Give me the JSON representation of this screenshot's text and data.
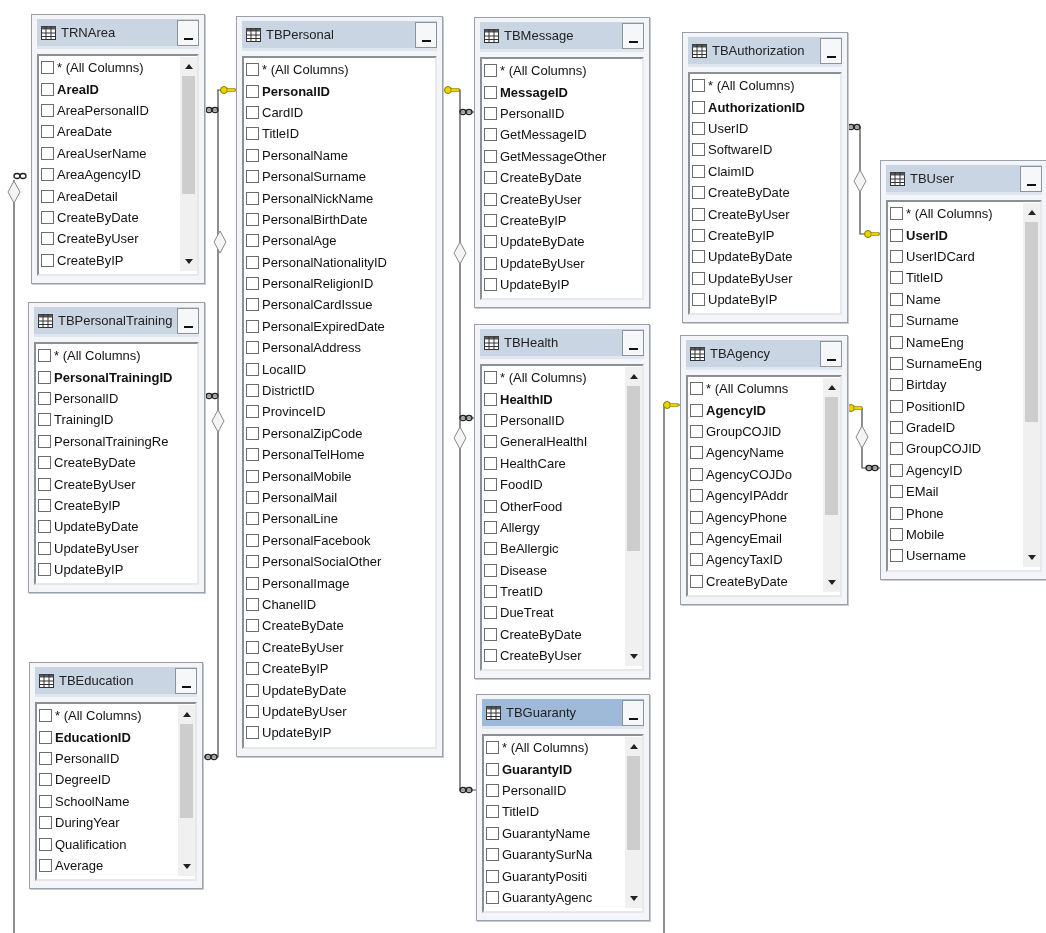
{
  "tables": [
    {
      "name": "TRNArea",
      "selected": false,
      "scrollable": true,
      "columns": [
        {
          "name": "* (All Columns)",
          "key": false,
          "checked": false
        },
        {
          "name": "AreaID",
          "key": true,
          "checked": false
        },
        {
          "name": "AreaPersonalID",
          "key": false,
          "checked": false
        },
        {
          "name": "AreaDate",
          "key": false,
          "checked": false
        },
        {
          "name": "AreaUserName",
          "key": false,
          "checked": false
        },
        {
          "name": "AreaAgencyID",
          "key": false,
          "checked": false
        },
        {
          "name": "AreaDetail",
          "key": false,
          "checked": false
        },
        {
          "name": "CreateByDate",
          "key": false,
          "checked": false
        },
        {
          "name": "CreateByUser",
          "key": false,
          "checked": false
        },
        {
          "name": "CreateByIP",
          "key": false,
          "checked": false
        }
      ]
    },
    {
      "name": "TBPersonal",
      "selected": false,
      "scrollable": false,
      "columns": [
        {
          "name": "* (All Columns)",
          "key": false,
          "checked": false
        },
        {
          "name": "PersonalID",
          "key": true,
          "checked": false
        },
        {
          "name": "CardID",
          "key": false,
          "checked": false
        },
        {
          "name": "TitleID",
          "key": false,
          "checked": false
        },
        {
          "name": "PersonalName",
          "key": false,
          "checked": false
        },
        {
          "name": "PersonalSurname",
          "key": false,
          "checked": false
        },
        {
          "name": "PersonalNickName",
          "key": false,
          "checked": false
        },
        {
          "name": "PersonalBirthDate",
          "key": false,
          "checked": false
        },
        {
          "name": "PersonalAge",
          "key": false,
          "checked": false
        },
        {
          "name": "PersonalNationalityID",
          "key": false,
          "checked": false
        },
        {
          "name": "PersonalReligionID",
          "key": false,
          "checked": false
        },
        {
          "name": "PersonalCardIssue",
          "key": false,
          "checked": false
        },
        {
          "name": "PersonalExpiredDate",
          "key": false,
          "checked": false
        },
        {
          "name": "PersonalAddress",
          "key": false,
          "checked": false
        },
        {
          "name": "LocalID",
          "key": false,
          "checked": false
        },
        {
          "name": "DistrictID",
          "key": false,
          "checked": false
        },
        {
          "name": "ProvinceID",
          "key": false,
          "checked": false
        },
        {
          "name": "PersonalZipCode",
          "key": false,
          "checked": false
        },
        {
          "name": "PersonalTelHome",
          "key": false,
          "checked": false
        },
        {
          "name": "PersonalMobile",
          "key": false,
          "checked": false
        },
        {
          "name": "PersonalMail",
          "key": false,
          "checked": false
        },
        {
          "name": "PersonalLine",
          "key": false,
          "checked": false
        },
        {
          "name": "PersonalFacebook",
          "key": false,
          "checked": false
        },
        {
          "name": "PersonalSocialOther",
          "key": false,
          "checked": false
        },
        {
          "name": "PersonalImage",
          "key": false,
          "checked": false
        },
        {
          "name": "ChanelID",
          "key": false,
          "checked": false
        },
        {
          "name": "CreateByDate",
          "key": false,
          "checked": false
        },
        {
          "name": "CreateByUser",
          "key": false,
          "checked": false
        },
        {
          "name": "CreateByIP",
          "key": false,
          "checked": false
        },
        {
          "name": "UpdateByDate",
          "key": false,
          "checked": false
        },
        {
          "name": "UpdateByUser",
          "key": false,
          "checked": false
        },
        {
          "name": "UpdateByIP",
          "key": false,
          "checked": false
        }
      ]
    },
    {
      "name": "TBMessage",
      "selected": false,
      "scrollable": false,
      "columns": [
        {
          "name": "* (All Columns)",
          "key": false,
          "checked": false
        },
        {
          "name": "MessageID",
          "key": true,
          "checked": false
        },
        {
          "name": "PersonalID",
          "key": false,
          "checked": false
        },
        {
          "name": "GetMessageID",
          "key": false,
          "checked": false
        },
        {
          "name": "GetMessageOther",
          "key": false,
          "checked": false
        },
        {
          "name": "CreateByDate",
          "key": false,
          "checked": false
        },
        {
          "name": "CreateByUser",
          "key": false,
          "checked": false
        },
        {
          "name": "CreateByIP",
          "key": false,
          "checked": false
        },
        {
          "name": "UpdateByDate",
          "key": false,
          "checked": false
        },
        {
          "name": "UpdateByUser",
          "key": false,
          "checked": false
        },
        {
          "name": "UpdateByIP",
          "key": false,
          "checked": false
        }
      ]
    },
    {
      "name": "TBAuthorization",
      "selected": false,
      "scrollable": false,
      "columns": [
        {
          "name": "* (All Columns)",
          "key": false,
          "checked": false
        },
        {
          "name": "AuthorizationID",
          "key": true,
          "checked": false
        },
        {
          "name": "UserID",
          "key": false,
          "checked": false
        },
        {
          "name": "SoftwareID",
          "key": false,
          "checked": false
        },
        {
          "name": "ClaimID",
          "key": false,
          "checked": false
        },
        {
          "name": "CreateByDate",
          "key": false,
          "checked": false
        },
        {
          "name": "CreateByUser",
          "key": false,
          "checked": false
        },
        {
          "name": "CreateByIP",
          "key": false,
          "checked": false
        },
        {
          "name": "UpdateByDate",
          "key": false,
          "checked": false
        },
        {
          "name": "UpdateByUser",
          "key": false,
          "checked": false
        },
        {
          "name": "UpdateByIP",
          "key": false,
          "checked": false
        }
      ]
    },
    {
      "name": "TBUser",
      "selected": false,
      "scrollable": true,
      "columns": [
        {
          "name": "* (All Columns)",
          "key": false,
          "checked": false
        },
        {
          "name": "UserID",
          "key": true,
          "checked": false
        },
        {
          "name": "UserIDCard",
          "key": false,
          "checked": false
        },
        {
          "name": "TitleID",
          "key": false,
          "checked": false
        },
        {
          "name": "Name",
          "key": false,
          "checked": false
        },
        {
          "name": "Surname",
          "key": false,
          "checked": false
        },
        {
          "name": "NameEng",
          "key": false,
          "checked": false
        },
        {
          "name": "SurnameEng",
          "key": false,
          "checked": false
        },
        {
          "name": "Birtday",
          "key": false,
          "checked": false
        },
        {
          "name": "PositionID",
          "key": false,
          "checked": false
        },
        {
          "name": "GradeID",
          "key": false,
          "checked": false
        },
        {
          "name": "GroupCOJID",
          "key": false,
          "checked": false
        },
        {
          "name": "AgencyID",
          "key": false,
          "checked": false
        },
        {
          "name": "EMail",
          "key": false,
          "checked": false
        },
        {
          "name": "Phone",
          "key": false,
          "checked": false
        },
        {
          "name": "Mobile",
          "key": false,
          "checked": false
        },
        {
          "name": "Username",
          "key": false,
          "checked": false
        }
      ]
    },
    {
      "name": "TBPersonalTraining",
      "selected": false,
      "scrollable": false,
      "columns": [
        {
          "name": "* (All Columns)",
          "key": false,
          "checked": false
        },
        {
          "name": "PersonalTrainingID",
          "key": true,
          "checked": false
        },
        {
          "name": "PersonalID",
          "key": false,
          "checked": false
        },
        {
          "name": "TrainingID",
          "key": false,
          "checked": false
        },
        {
          "name": "PersonalTrainingRe",
          "key": false,
          "checked": false
        },
        {
          "name": "CreateByDate",
          "key": false,
          "checked": false
        },
        {
          "name": "CreateByUser",
          "key": false,
          "checked": false
        },
        {
          "name": "CreateByIP",
          "key": false,
          "checked": false
        },
        {
          "name": "UpdateByDate",
          "key": false,
          "checked": false
        },
        {
          "name": "UpdateByUser",
          "key": false,
          "checked": false
        },
        {
          "name": "UpdateByIP",
          "key": false,
          "checked": false
        }
      ]
    },
    {
      "name": "TBHealth",
      "selected": false,
      "scrollable": true,
      "columns": [
        {
          "name": "* (All Columns)",
          "key": false,
          "checked": false
        },
        {
          "name": "HealthID",
          "key": true,
          "checked": false
        },
        {
          "name": "PersonalID",
          "key": false,
          "checked": false
        },
        {
          "name": "GeneralHealthI",
          "key": false,
          "checked": false
        },
        {
          "name": "HealthCare",
          "key": false,
          "checked": false
        },
        {
          "name": "FoodID",
          "key": false,
          "checked": false
        },
        {
          "name": "OtherFood",
          "key": false,
          "checked": false
        },
        {
          "name": "Allergy",
          "key": false,
          "checked": false
        },
        {
          "name": "BeAllergic",
          "key": false,
          "checked": false
        },
        {
          "name": "Disease",
          "key": false,
          "checked": false
        },
        {
          "name": "TreatID",
          "key": false,
          "checked": false
        },
        {
          "name": "DueTreat",
          "key": false,
          "checked": false
        },
        {
          "name": "CreateByDate",
          "key": false,
          "checked": false
        },
        {
          "name": "CreateByUser",
          "key": false,
          "checked": false
        }
      ]
    },
    {
      "name": "TBAgency",
      "selected": false,
      "scrollable": true,
      "columns": [
        {
          "name": "* (All Columns",
          "key": false,
          "checked": false
        },
        {
          "name": "AgencyID",
          "key": true,
          "checked": false
        },
        {
          "name": "GroupCOJID",
          "key": false,
          "checked": false
        },
        {
          "name": "AgencyName",
          "key": false,
          "checked": false
        },
        {
          "name": "AgencyCOJDo",
          "key": false,
          "checked": false
        },
        {
          "name": "AgencyIPAddr",
          "key": false,
          "checked": false
        },
        {
          "name": "AgencyPhone",
          "key": false,
          "checked": false
        },
        {
          "name": "AgencyEmail",
          "key": false,
          "checked": false
        },
        {
          "name": "AgencyTaxID",
          "key": false,
          "checked": false
        },
        {
          "name": "CreateByDate",
          "key": false,
          "checked": false
        }
      ]
    },
    {
      "name": "TBEducation",
      "selected": false,
      "scrollable": true,
      "columns": [
        {
          "name": "* (All Columns)",
          "key": false,
          "checked": false
        },
        {
          "name": "EducationID",
          "key": true,
          "checked": false
        },
        {
          "name": "PersonalID",
          "key": false,
          "checked": false
        },
        {
          "name": "DegreeID",
          "key": false,
          "checked": false
        },
        {
          "name": "SchoolName",
          "key": false,
          "checked": false
        },
        {
          "name": "DuringYear",
          "key": false,
          "checked": false
        },
        {
          "name": "Qualification",
          "key": false,
          "checked": false
        },
        {
          "name": "Average",
          "key": false,
          "checked": false
        }
      ]
    },
    {
      "name": "TBGuaranty",
      "selected": true,
      "scrollable": true,
      "columns": [
        {
          "name": "* (All Columns)",
          "key": false,
          "checked": false
        },
        {
          "name": "GuarantyID",
          "key": true,
          "checked": false
        },
        {
          "name": "PersonalID",
          "key": false,
          "checked": false
        },
        {
          "name": "TitleID",
          "key": false,
          "checked": false
        },
        {
          "name": "GuarantyName",
          "key": false,
          "checked": false
        },
        {
          "name": "GuarantySurNa",
          "key": false,
          "checked": false
        },
        {
          "name": "GuarantyPositi",
          "key": false,
          "checked": false
        },
        {
          "name": "GuarantyAgenc",
          "key": false,
          "checked": false
        }
      ]
    }
  ]
}
